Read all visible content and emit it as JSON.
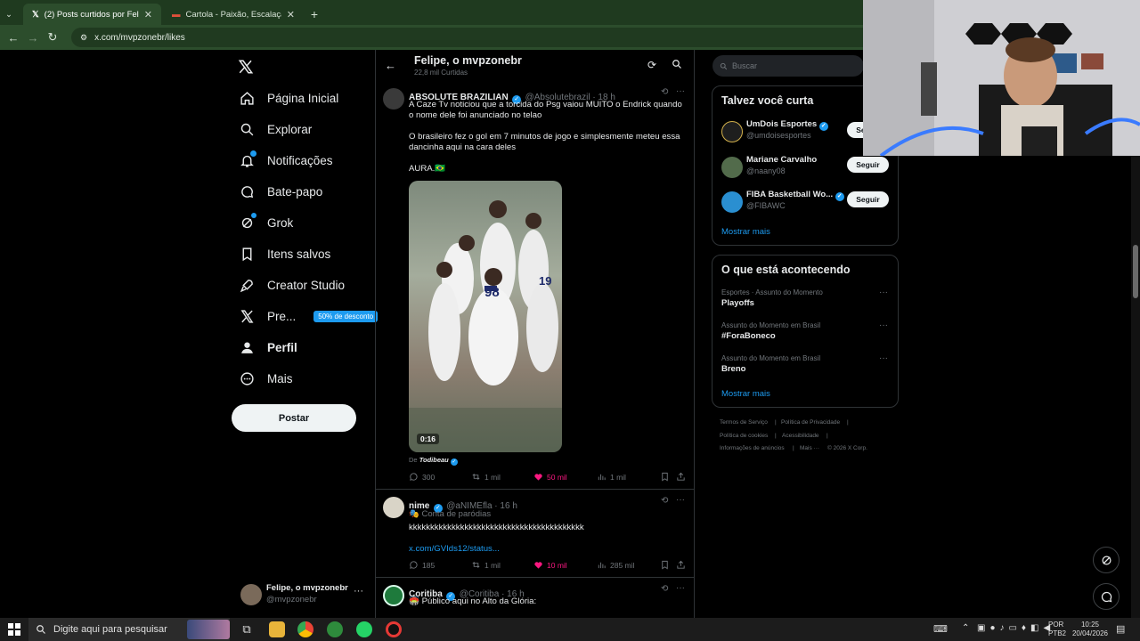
{
  "browser": {
    "tabs": [
      {
        "label": "(2) Posts curtidos por Felipe, o m",
        "active": true
      },
      {
        "label": "Cartola - Paixão, Escalação, Zoa",
        "active": false
      }
    ],
    "url": "x.com/mvpzonebr/likes"
  },
  "nav": {
    "items": [
      {
        "label": "Página Inicial",
        "icon": "home-icon"
      },
      {
        "label": "Explorar",
        "icon": "search-icon"
      },
      {
        "label": "Notificações",
        "icon": "bell-icon"
      },
      {
        "label": "Bate-papo",
        "icon": "chat-icon"
      },
      {
        "label": "Grok",
        "icon": "grok-icon"
      },
      {
        "label": "Itens salvos",
        "icon": "bookmark-icon"
      },
      {
        "label": "Creator Studio",
        "icon": "rocket-icon"
      },
      {
        "label": "Pre...",
        "icon": "x-icon"
      },
      {
        "label": "Perfil",
        "icon": "person-icon"
      },
      {
        "label": "Mais",
        "icon": "more-icon"
      }
    ],
    "promo_badge": "50% de desconto",
    "post_button": "Postar",
    "account": {
      "name": "Felipe, o mvpzonebr",
      "handle": "@mvpzonebr"
    }
  },
  "header": {
    "title": "Felipe, o mvpzonebr",
    "subtitle": "22,8 mil Curtidas"
  },
  "tweets": [
    {
      "name": "ABSOLUTE BRAZILIAN",
      "handle": "@Absolutebrazil · 18 h",
      "text1": "A Caze Tv noticiou que a torcida do Psg vaiou MUITO o Endrick quando o nome dele foi anunciado no telao",
      "text2": "O brasileiro fez o gol em 7 minutos de jogo e simplesmente meteu essa dancinha aqui na cara deles",
      "text3": "AURA.🇧🇷",
      "video_duration": "0:16",
      "from_label": "De",
      "from_name": "Todibeau",
      "stats": {
        "replies": "300",
        "retweets": "1 mil",
        "likes": "50 mil",
        "views": "1 mil"
      }
    },
    {
      "name": "nime",
      "handle": "@aNIMEfla · 16 h",
      "parody": "Conta de paródias",
      "text1": "kkkkkkkkkkkkkkkkkkkkkkkkkkkkkkkkkkkkkkkkk",
      "link": "x.com/GVIds12/status...",
      "stats": {
        "replies": "185",
        "retweets": "1 mil",
        "likes": "10 mil",
        "views": "285 mil"
      }
    },
    {
      "name": "Coritiba",
      "handle": "@Coritiba · 16 h",
      "text1": "🏟️ Público aqui no Alto da Glória:"
    }
  ],
  "search": {
    "placeholder": "Buscar"
  },
  "suggestions": {
    "title": "Talvez você curta",
    "users": [
      {
        "name": "UmDois Esportes",
        "handle": "@umdoisesportes",
        "button": "Seguir"
      },
      {
        "name": "Mariane Carvalho",
        "handle": "@naany08",
        "button": "Seguir"
      },
      {
        "name": "FIBA Basketball Wo...",
        "handle": "@FIBAWC",
        "button": "Seguir"
      }
    ],
    "more": "Mostrar mais"
  },
  "trends": {
    "title": "O que está acontecendo",
    "items": [
      {
        "context": "Esportes · Assunto do Momento",
        "topic": "Playoffs"
      },
      {
        "context": "Assunto do Momento em Brasil",
        "topic": "#ForaBoneco"
      },
      {
        "context": "Assunto do Momento em Brasil",
        "topic": "Breno"
      }
    ],
    "more": "Mostrar mais"
  },
  "footer": {
    "links": [
      "Termos de Serviço",
      "Política de Privacidade",
      "Política de cookies",
      "Acessibilidade",
      "Informações de anúncios",
      "Mais ···",
      "© 2026 X Corp."
    ]
  },
  "taskbar": {
    "search_placeholder": "Digite aqui para pesquisar",
    "lang": "POR",
    "layout": "PTB2",
    "time": "10:25",
    "date": "20/04/2026"
  }
}
